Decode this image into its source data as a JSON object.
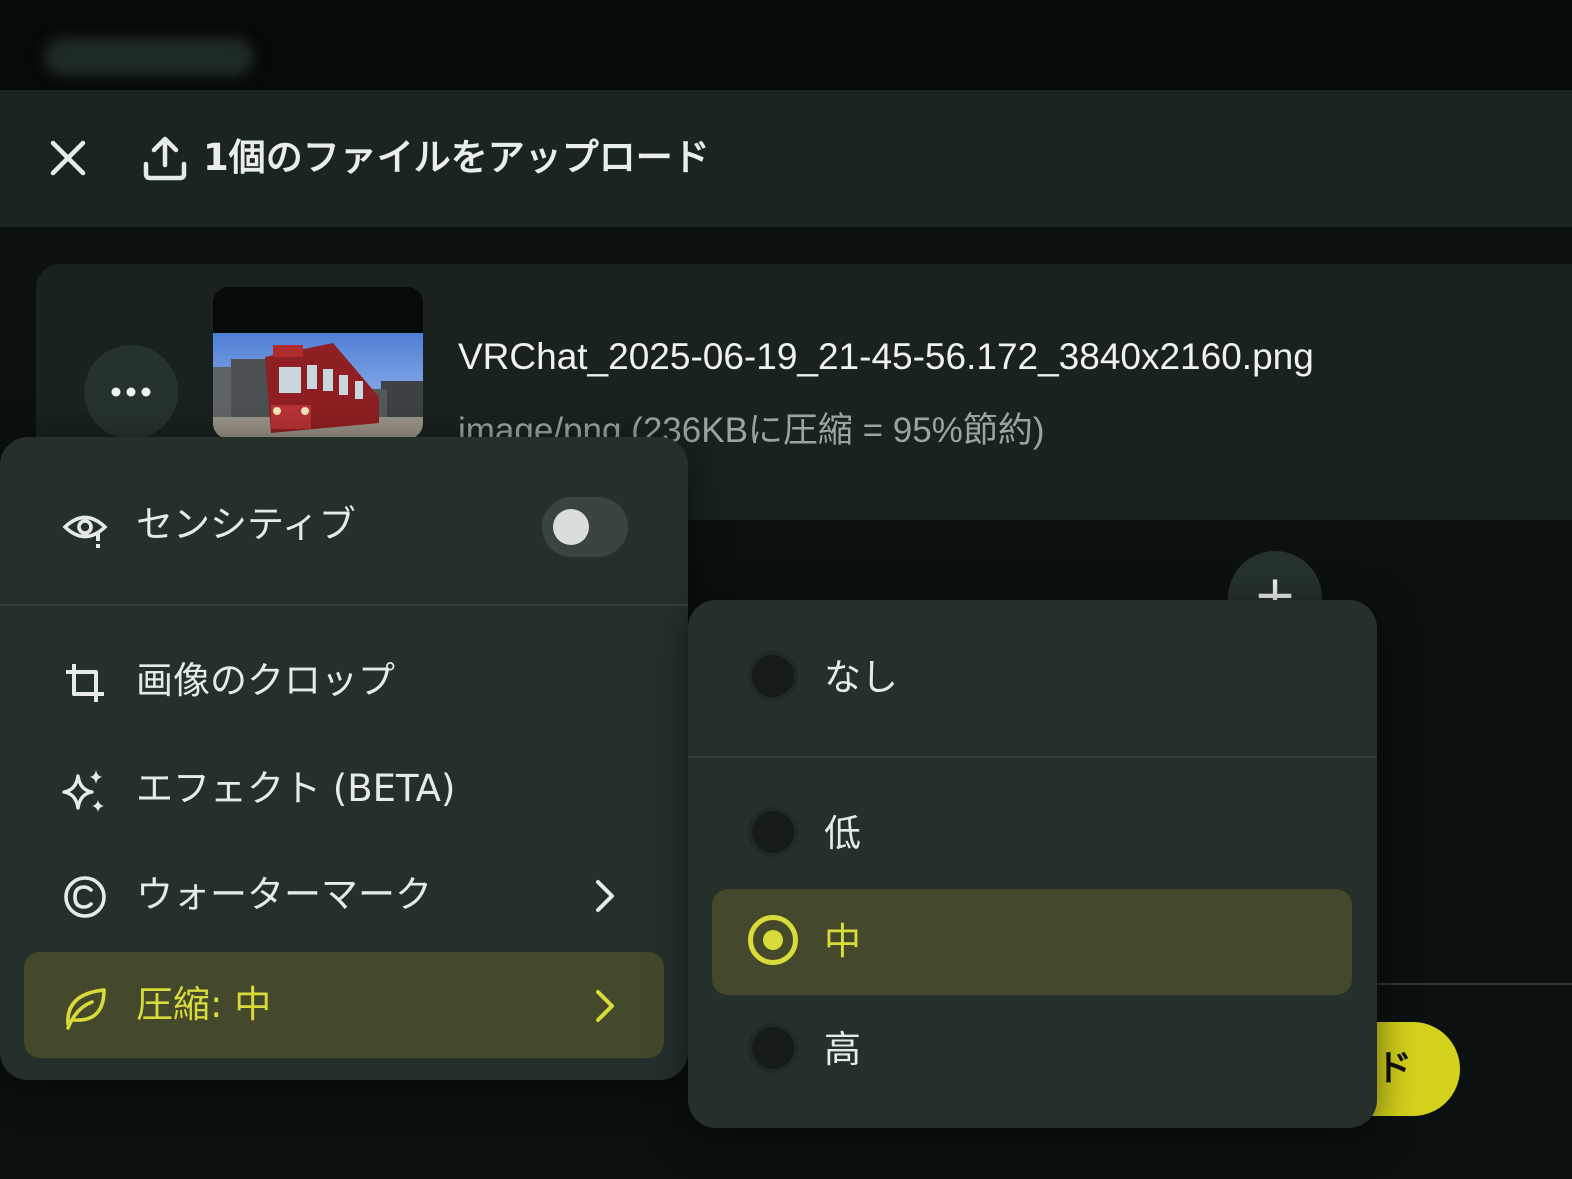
{
  "header": {
    "close_icon": "close-icon",
    "upload_icon": "upload-icon",
    "title": "1個のファイルをアップロード"
  },
  "file": {
    "name": "VRChat_2025-06-19_21-45-56.172_3840x2160.png",
    "meta": "image/png  (236KBに圧縮 = 95%節約)"
  },
  "upload_button": {
    "label": "ド"
  },
  "context_menu": {
    "items": [
      {
        "label": "センシティブ",
        "icon": "eye-alert-icon",
        "toggle": false
      },
      {
        "label": "画像のクロップ",
        "icon": "crop-icon"
      },
      {
        "label": "エフェクト (BETA)",
        "icon": "sparkles-icon"
      },
      {
        "label": "ウォーターマーク",
        "icon": "copyright-icon",
        "submenu": true
      },
      {
        "label": "圧縮: 中",
        "icon": "leaf-icon",
        "submenu": true,
        "selected": true
      }
    ]
  },
  "compression_menu": {
    "options": [
      {
        "label": "なし",
        "selected": false
      },
      {
        "label": "低",
        "selected": false
      },
      {
        "label": "中",
        "selected": true
      },
      {
        "label": "高",
        "selected": false
      }
    ]
  },
  "colors": {
    "accent": "#d9db3a",
    "selected_bg": "#45492c",
    "menu_bg": "#25302d",
    "page_bg": "#0b1110"
  }
}
